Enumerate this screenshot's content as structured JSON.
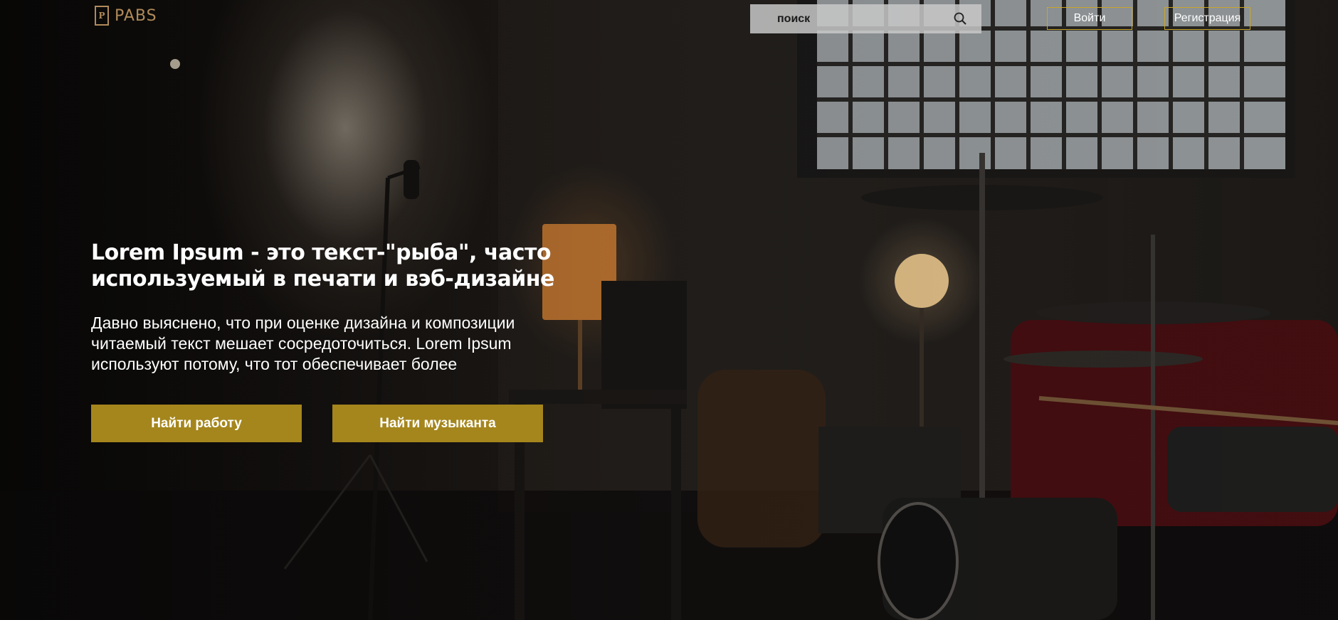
{
  "header": {
    "logo_mark": "P",
    "logo_text": "PABS",
    "search_placeholder": "поиск",
    "login_label": "Войти",
    "register_label": "Регистрация"
  },
  "hero": {
    "headline": "Lorem Ipsum - это текст-\"рыба\", часто используемый в печати и вэб-дизайне",
    "subtext": "Давно выяснено, что при оценке дизайна и композиции читаемый текст мешает сосредоточиться. Lorem Ipsum используют потому, что тот обеспечивает более",
    "find_job_label": "Найти работу",
    "find_musician_label": "Найти музыканта"
  },
  "colors": {
    "accent": "#a5861c",
    "accent_border": "#c9a62a",
    "logo": "#b08a5a",
    "text": "#ffffff"
  },
  "icons": {
    "search": "search-icon",
    "logo": "logo-icon"
  }
}
